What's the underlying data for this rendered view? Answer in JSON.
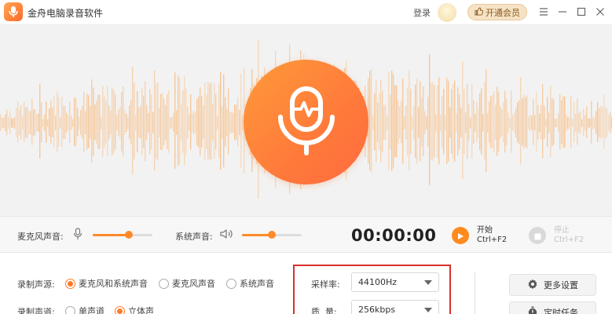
{
  "app": {
    "title": "金舟电脑录音软件",
    "logo_icon": "microphone-logo-icon",
    "accent_color": "#ff7a2a"
  },
  "header": {
    "login_label": "登录",
    "vip_label": "开通会员",
    "vip_icon": "thumbs-up-icon",
    "window_controls": [
      "menu-icon",
      "minimize-icon",
      "maximize-icon",
      "close-icon"
    ]
  },
  "record_button": {
    "icon": "microphone-icon"
  },
  "controls": {
    "mic_volume_label": "麦克风声音:",
    "mic_volume_icon": "microphone-icon",
    "mic_volume_level": 0.6,
    "system_volume_label": "系统声音:",
    "system_volume_icon": "speaker-icon",
    "system_volume_level": 0.5,
    "timer": "00:00:00",
    "start_label": "开始",
    "start_shortcut": "Ctrl+F2",
    "stop_label": "停止",
    "stop_shortcut": "Ctrl+F2"
  },
  "settings": {
    "source_label": "录制声源:",
    "source_options": [
      "麦克风和系统声音",
      "麦克风声音",
      "系统声音"
    ],
    "source_selected": "麦克风和系统声音",
    "channel_label": "录制声道:",
    "channel_options": [
      "单声道",
      "立体声"
    ],
    "channel_selected": "立体声",
    "sample_rate_label": "采样率:",
    "sample_rate_value": "44100Hz",
    "quality_label": "质  量:",
    "quality_value": "256kbps",
    "more_settings_label": "更多设置",
    "more_settings_icon": "gear-icon",
    "scheduled_task_label": "定时任务",
    "scheduled_task_icon": "stopwatch-icon"
  }
}
